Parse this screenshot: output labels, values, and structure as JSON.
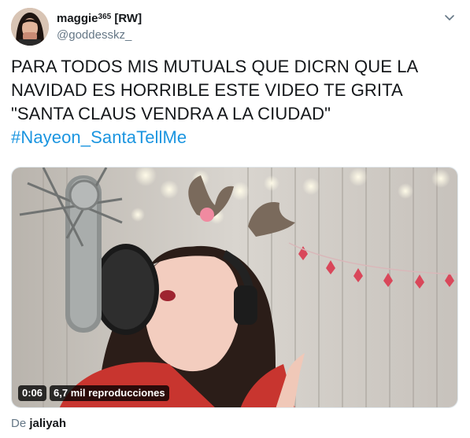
{
  "user": {
    "display_name": "maggie",
    "superscript": "365",
    "tag": "[RW]",
    "handle": "@goddesskz_"
  },
  "tweet": {
    "text": "PARA TODOS MIS MUTUALS QUE DICRN QUE LA NAVIDAD ES HORRIBLE ESTE VIDEO TE GRITA \"SANTA CLAUS VENDRA A LA CIUDAD\"",
    "hashtag": "#Nayeon_SantaTellMe"
  },
  "video": {
    "duration": "0:06",
    "views": "6,7 mil reproducciones"
  },
  "footer": {
    "prefix": "De",
    "author": "jaliyah"
  },
  "icons": {
    "caret": "chevron-down-icon"
  },
  "colors": {
    "hashtag": "#1b95e0",
    "secondary_text": "#657786"
  }
}
